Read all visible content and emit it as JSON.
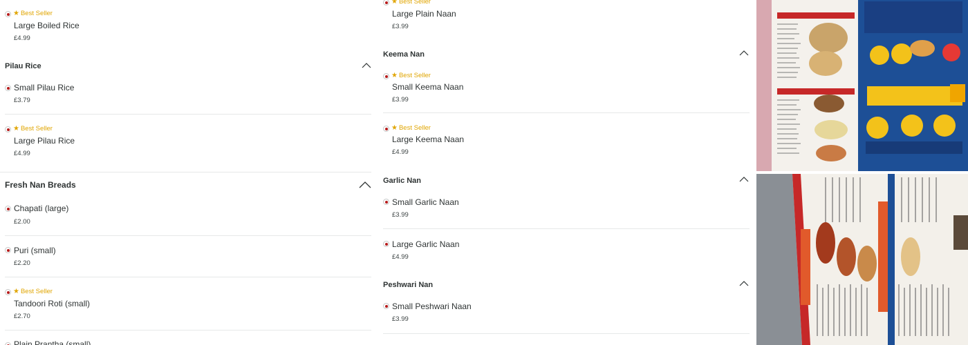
{
  "best_seller_label": "Best Seller",
  "left_column": {
    "items_top": [
      {
        "name": "Large Boiled Rice",
        "price": "£4.99",
        "best_seller": true
      }
    ],
    "sections": [
      {
        "title": "Pilau Rice",
        "items": [
          {
            "name": "Small Pilau Rice",
            "price": "£3.79",
            "best_seller": false
          },
          {
            "name": "Large Pilau Rice",
            "price": "£4.99",
            "best_seller": true
          }
        ]
      },
      {
        "title": "Fresh Nan Breads",
        "items": [
          {
            "name": "Chapati (large)",
            "price": "£2.00",
            "best_seller": false
          },
          {
            "name": "Puri (small)",
            "price": "£2.20",
            "best_seller": false
          },
          {
            "name": "Tandoori Roti (small)",
            "price": "£2.70",
            "best_seller": true
          },
          {
            "name": "Plain Prantha (small)",
            "price": "",
            "best_seller": false
          }
        ]
      }
    ]
  },
  "middle_column": {
    "items_top": [
      {
        "name": "Large Plain Naan",
        "price": "£3.99",
        "best_seller": true
      }
    ],
    "sections": [
      {
        "title": "Keema Nan",
        "items": [
          {
            "name": "Small Keema Naan",
            "price": "£3.99",
            "best_seller": true
          },
          {
            "name": "Large Keema Naan",
            "price": "£4.99",
            "best_seller": true
          }
        ]
      },
      {
        "title": "Garlic Nan",
        "items": [
          {
            "name": "Small Garlic Naan",
            "price": "£3.99",
            "best_seller": false
          },
          {
            "name": "Large Garlic Naan",
            "price": "£4.99",
            "best_seller": false
          }
        ]
      },
      {
        "title": "Peshwari Nan",
        "items": [
          {
            "name": "Small Peshwari Naan",
            "price": "£3.99",
            "best_seller": false
          }
        ]
      }
    ]
  },
  "photos": {
    "top": {
      "menu_lines": [
        "PIZZAS · CHIPS · BURGERS · KEBABS",
        "SOUTHERN FRIED CHICKEN",
        "THE BEST INDIAN CUISINE"
      ],
      "headings": [
        "FRESH NAN BREADS",
        "EXTRAS",
        "FREE DELIVERY SERVICE",
        "SPECIAL CURRY MEAL DEAL",
        "£13"
      ]
    },
    "bottom": {
      "headings": [
        "STARTERS",
        "VEGETARIAN STARTERS"
      ]
    }
  },
  "colors": {
    "accent_red": "#b71b1b",
    "best_seller_gold": "#e0a500",
    "divider": "#e6e8e8",
    "chevron": "#2e3333"
  }
}
